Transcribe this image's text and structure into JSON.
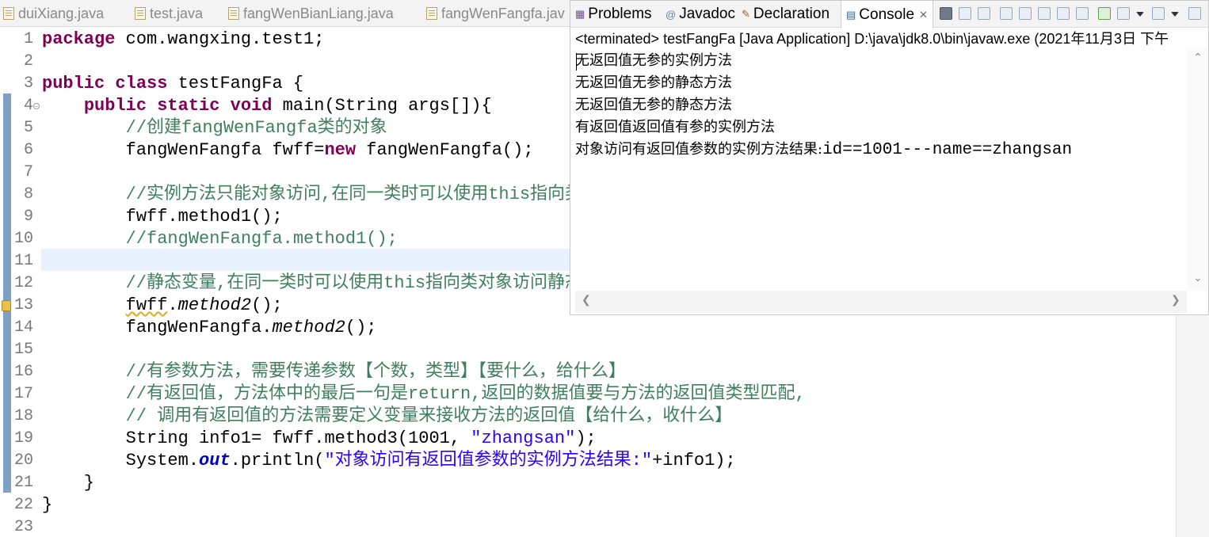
{
  "editor_tabs": [
    {
      "label": "duiXiang.java"
    },
    {
      "label": "test.java"
    },
    {
      "label": "fangWenBianLiang.java"
    },
    {
      "label": "fangWenFangfa.jav"
    }
  ],
  "code": {
    "line_numbers": [
      "1",
      "2",
      "3",
      "4",
      "5",
      "6",
      "7",
      "8",
      "9",
      "10",
      "11",
      "12",
      "13",
      "14",
      "15",
      "16",
      "17",
      "18",
      "19",
      "20",
      "21",
      "22",
      "23"
    ],
    "lines": [
      [
        {
          "t": "package",
          "c": "kw"
        },
        {
          "t": " com.wangxing.test1;"
        }
      ],
      [],
      [
        {
          "t": "public",
          "c": "kw"
        },
        {
          "t": " "
        },
        {
          "t": "class",
          "c": "kw"
        },
        {
          "t": " testFangFa {"
        }
      ],
      [
        {
          "t": "    "
        },
        {
          "t": "public",
          "c": "kw"
        },
        {
          "t": " "
        },
        {
          "t": "static",
          "c": "kw"
        },
        {
          "t": " "
        },
        {
          "t": "void",
          "c": "kw"
        },
        {
          "t": " main(String args[]){"
        }
      ],
      [
        {
          "t": "        "
        },
        {
          "t": "//创建fangWenFangfa类的对象",
          "c": "cm"
        }
      ],
      [
        {
          "t": "        fangWenFangfa fwff="
        },
        {
          "t": "new",
          "c": "kw"
        },
        {
          "t": " fangWenFangfa();"
        }
      ],
      [],
      [
        {
          "t": "        "
        },
        {
          "t": "//实例方法只能对象访问,在同一类时可以使用this指向类对象访问",
          "c": "cm"
        }
      ],
      [
        {
          "t": "        fwff.method1();"
        }
      ],
      [
        {
          "t": "        "
        },
        {
          "t": "//fangWenFangfa.method1();",
          "c": "cm"
        }
      ],
      [],
      [
        {
          "t": "        "
        },
        {
          "t": "//静态变量,在同一类时可以使用this指向类对象访问静态方法",
          "c": "cm"
        }
      ],
      [
        {
          "t": "        "
        },
        {
          "t": "fwff",
          "c": "wavy"
        },
        {
          "t": "."
        },
        {
          "t": "method2",
          "c": "it"
        },
        {
          "t": "();"
        }
      ],
      [
        {
          "t": "        fangWenFangfa."
        },
        {
          "t": "method2",
          "c": "it"
        },
        {
          "t": "();"
        }
      ],
      [],
      [
        {
          "t": "        "
        },
        {
          "t": "//有参数方法，需要传递参数【个数，类型】【要什么，给什么】",
          "c": "cm"
        }
      ],
      [
        {
          "t": "        "
        },
        {
          "t": "//有返回值，方法体中的最后一句是return,返回的数据值要与方法的返回值类型匹配,",
          "c": "cm"
        }
      ],
      [
        {
          "t": "        "
        },
        {
          "t": "// 调用有返回值的方法需要定义变量来接收方法的返回值【给什么，收什么】",
          "c": "cm"
        }
      ],
      [
        {
          "t": "        String info1= fwff.method3(1001, "
        },
        {
          "t": "\"zhangsan\"",
          "c": "st"
        },
        {
          "t": ");"
        }
      ],
      [
        {
          "t": "        System."
        },
        {
          "t": "out",
          "c": "fld"
        },
        {
          "t": ".println("
        },
        {
          "t": "\"对象访问有返回值参数的实例方法结果:\"",
          "c": "st"
        },
        {
          "t": "+info1);"
        }
      ],
      [
        {
          "t": "    }"
        }
      ],
      [
        {
          "t": "}"
        }
      ],
      []
    ]
  },
  "console": {
    "tabs": [
      {
        "label": "Problems"
      },
      {
        "label": "Javadoc"
      },
      {
        "label": "Declaration"
      },
      {
        "label": "Console"
      }
    ],
    "header": "<terminated> testFangFa [Java Application] D:\\java\\jdk8.0\\bin\\javaw.exe (2021年11月3日 下午",
    "output": [
      {
        "text": "无返回值无参的实例方法"
      },
      {
        "text": "无返回值无参的静态方法"
      },
      {
        "text": "无返回值无参的静态方法"
      },
      {
        "text": "有返回值返回值有参的实例方法"
      },
      {
        "text": "对象访问有返回值参数的实例方法结果:",
        "mono": "id==1001---name==zhangsan"
      }
    ]
  },
  "icons": {
    "file": "java-file-icon",
    "problems": "problems-icon",
    "javadoc": "at-icon",
    "declaration": "declaration-icon",
    "console": "console-icon",
    "close": "close-icon"
  },
  "colors": {
    "keyword": "#7f0055",
    "comment": "#3f7f5f",
    "string": "#2a00ff",
    "field": "#0000c0",
    "current_line": "#e8f2fe"
  }
}
